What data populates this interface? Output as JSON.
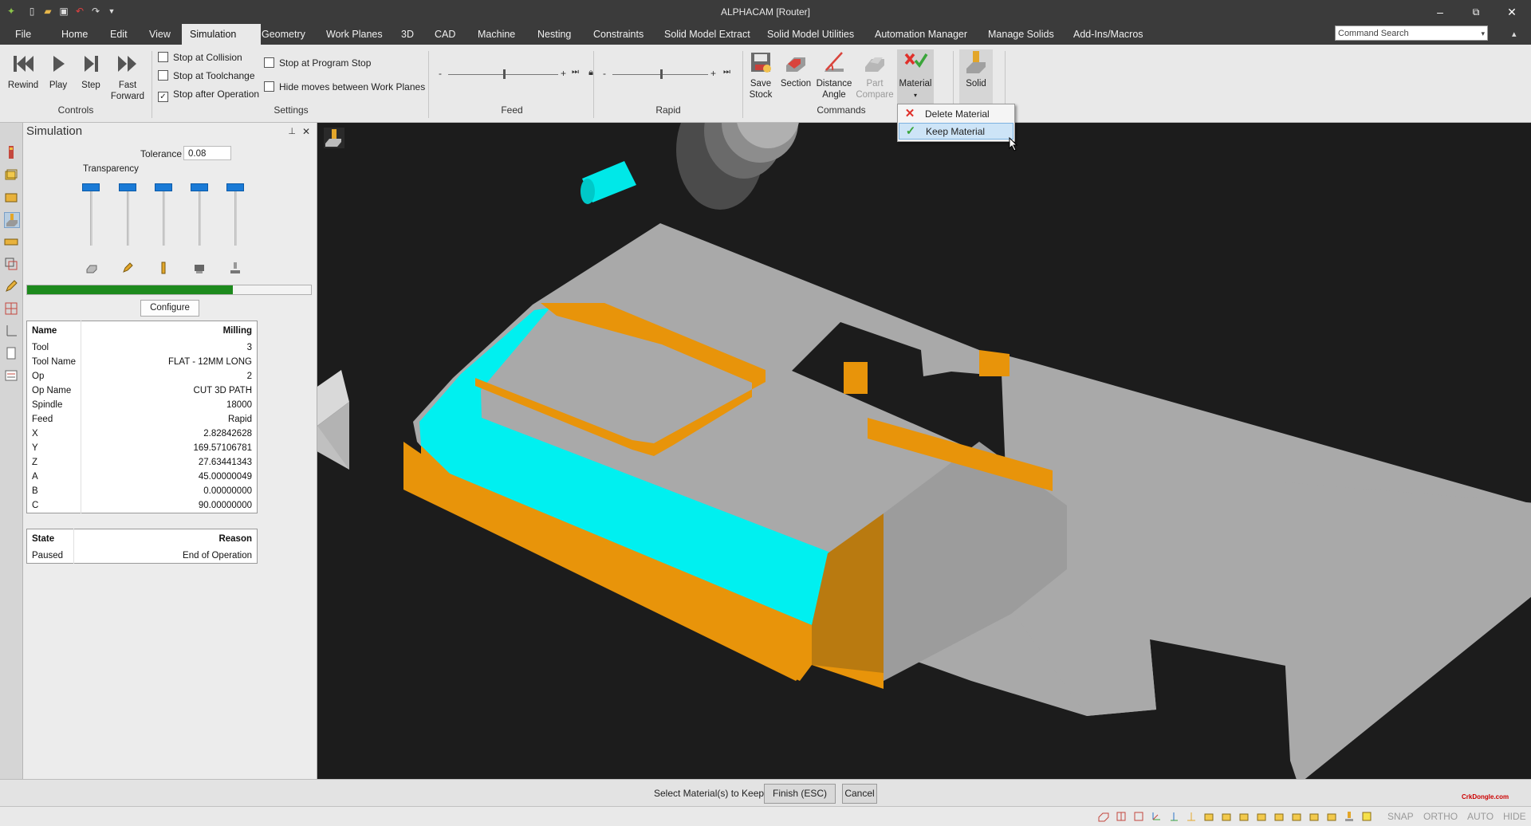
{
  "app": {
    "title": "ALPHACAM [Router]"
  },
  "window_controls": {
    "minimize": "–",
    "restore": "⧉",
    "close": "✕"
  },
  "menu_tabs": [
    "File",
    "Home",
    "Edit",
    "View",
    "Simulation",
    "Geometry",
    "Work Planes",
    "3D",
    "CAD",
    "Machine",
    "Nesting",
    "Constraints",
    "Solid Model Extract",
    "Solid Model Utilities",
    "Automation Manager",
    "Manage Solids",
    "Add-Ins/Macros"
  ],
  "active_tab": "Simulation",
  "command_search": {
    "placeholder": "Command Search"
  },
  "ribbon": {
    "controls": {
      "label": "Controls",
      "rewind": "Rewind",
      "play": "Play",
      "step": "Step",
      "fast_forward_1": "Fast",
      "fast_forward_2": "Forward"
    },
    "settings": {
      "label": "Settings",
      "stop_at_collision": "Stop at Collision",
      "stop_at_toolchange": "Stop at Toolchange",
      "stop_after_operation": "Stop after Operation",
      "stop_at_program_stop": "Stop at Program Stop",
      "hide_moves": "Hide moves between Work Planes",
      "checked": {
        "stop_at_collision": false,
        "stop_at_toolchange": false,
        "stop_after_operation": true,
        "stop_at_program_stop": false,
        "hide_moves": false
      }
    },
    "feed": {
      "label": "Feed",
      "minus": "-",
      "plus": "+",
      "level": 0.5
    },
    "rapid": {
      "label": "Rapid",
      "minus": "-",
      "plus": "+",
      "level": 0.5
    },
    "commands": {
      "label": "Commands",
      "save_stock_1": "Save",
      "save_stock_2": "Stock",
      "section": "Section",
      "distance_angle_1": "Distance",
      "distance_angle_2": "Angle",
      "part_compare_1": "Part",
      "part_compare_2": "Compare",
      "material": "Material",
      "solid": "Solid"
    }
  },
  "material_menu": {
    "items": [
      "Delete Material",
      "Keep Material"
    ],
    "highlighted": "Keep Material"
  },
  "simulation_panel": {
    "title": "Simulation",
    "pin": "📌",
    "close": "✕",
    "tolerance_label": "Tolerance",
    "tolerance_value": "0.08",
    "transparency_label": "Transparency",
    "progress_fraction": 0.725,
    "configure": "Configure",
    "info_header": {
      "name": "Name",
      "value": "Milling"
    },
    "info_rows": [
      {
        "name": "Tool",
        "value": "3"
      },
      {
        "name": "Tool Name",
        "value": "FLAT - 12MM LONG"
      },
      {
        "name": "Op",
        "value": "2"
      },
      {
        "name": "Op Name",
        "value": "CUT 3D PATH"
      },
      {
        "name": "Spindle",
        "value": "18000"
      },
      {
        "name": "Feed",
        "value": "Rapid"
      },
      {
        "name": "X",
        "value": "2.82842628"
      },
      {
        "name": "Y",
        "value": "169.57106781"
      },
      {
        "name": "Z",
        "value": "27.63441343"
      },
      {
        "name": "A",
        "value": "45.00000049"
      },
      {
        "name": "B",
        "value": "0.00000000"
      },
      {
        "name": "C",
        "value": "90.00000000"
      }
    ],
    "state_header": {
      "name": "State",
      "value": "Reason"
    },
    "state_row": {
      "name": "Paused",
      "value": "End of Operation"
    }
  },
  "command_bar": {
    "prompt": "Select Material(s) to Keep",
    "finish": "Finish (ESC)",
    "cancel": "Cancel"
  },
  "watermark": "CrkDongle.com",
  "status_bar": {
    "snap": "SNAP",
    "ortho": "ORTHO",
    "auto": "AUTO",
    "hide": "HIDE"
  },
  "colors": {
    "accent_orange": "#e8940a",
    "cyan": "#00f0f0",
    "stock_grey": "#a8a8a8",
    "progress_green": "#1d8a1d"
  }
}
